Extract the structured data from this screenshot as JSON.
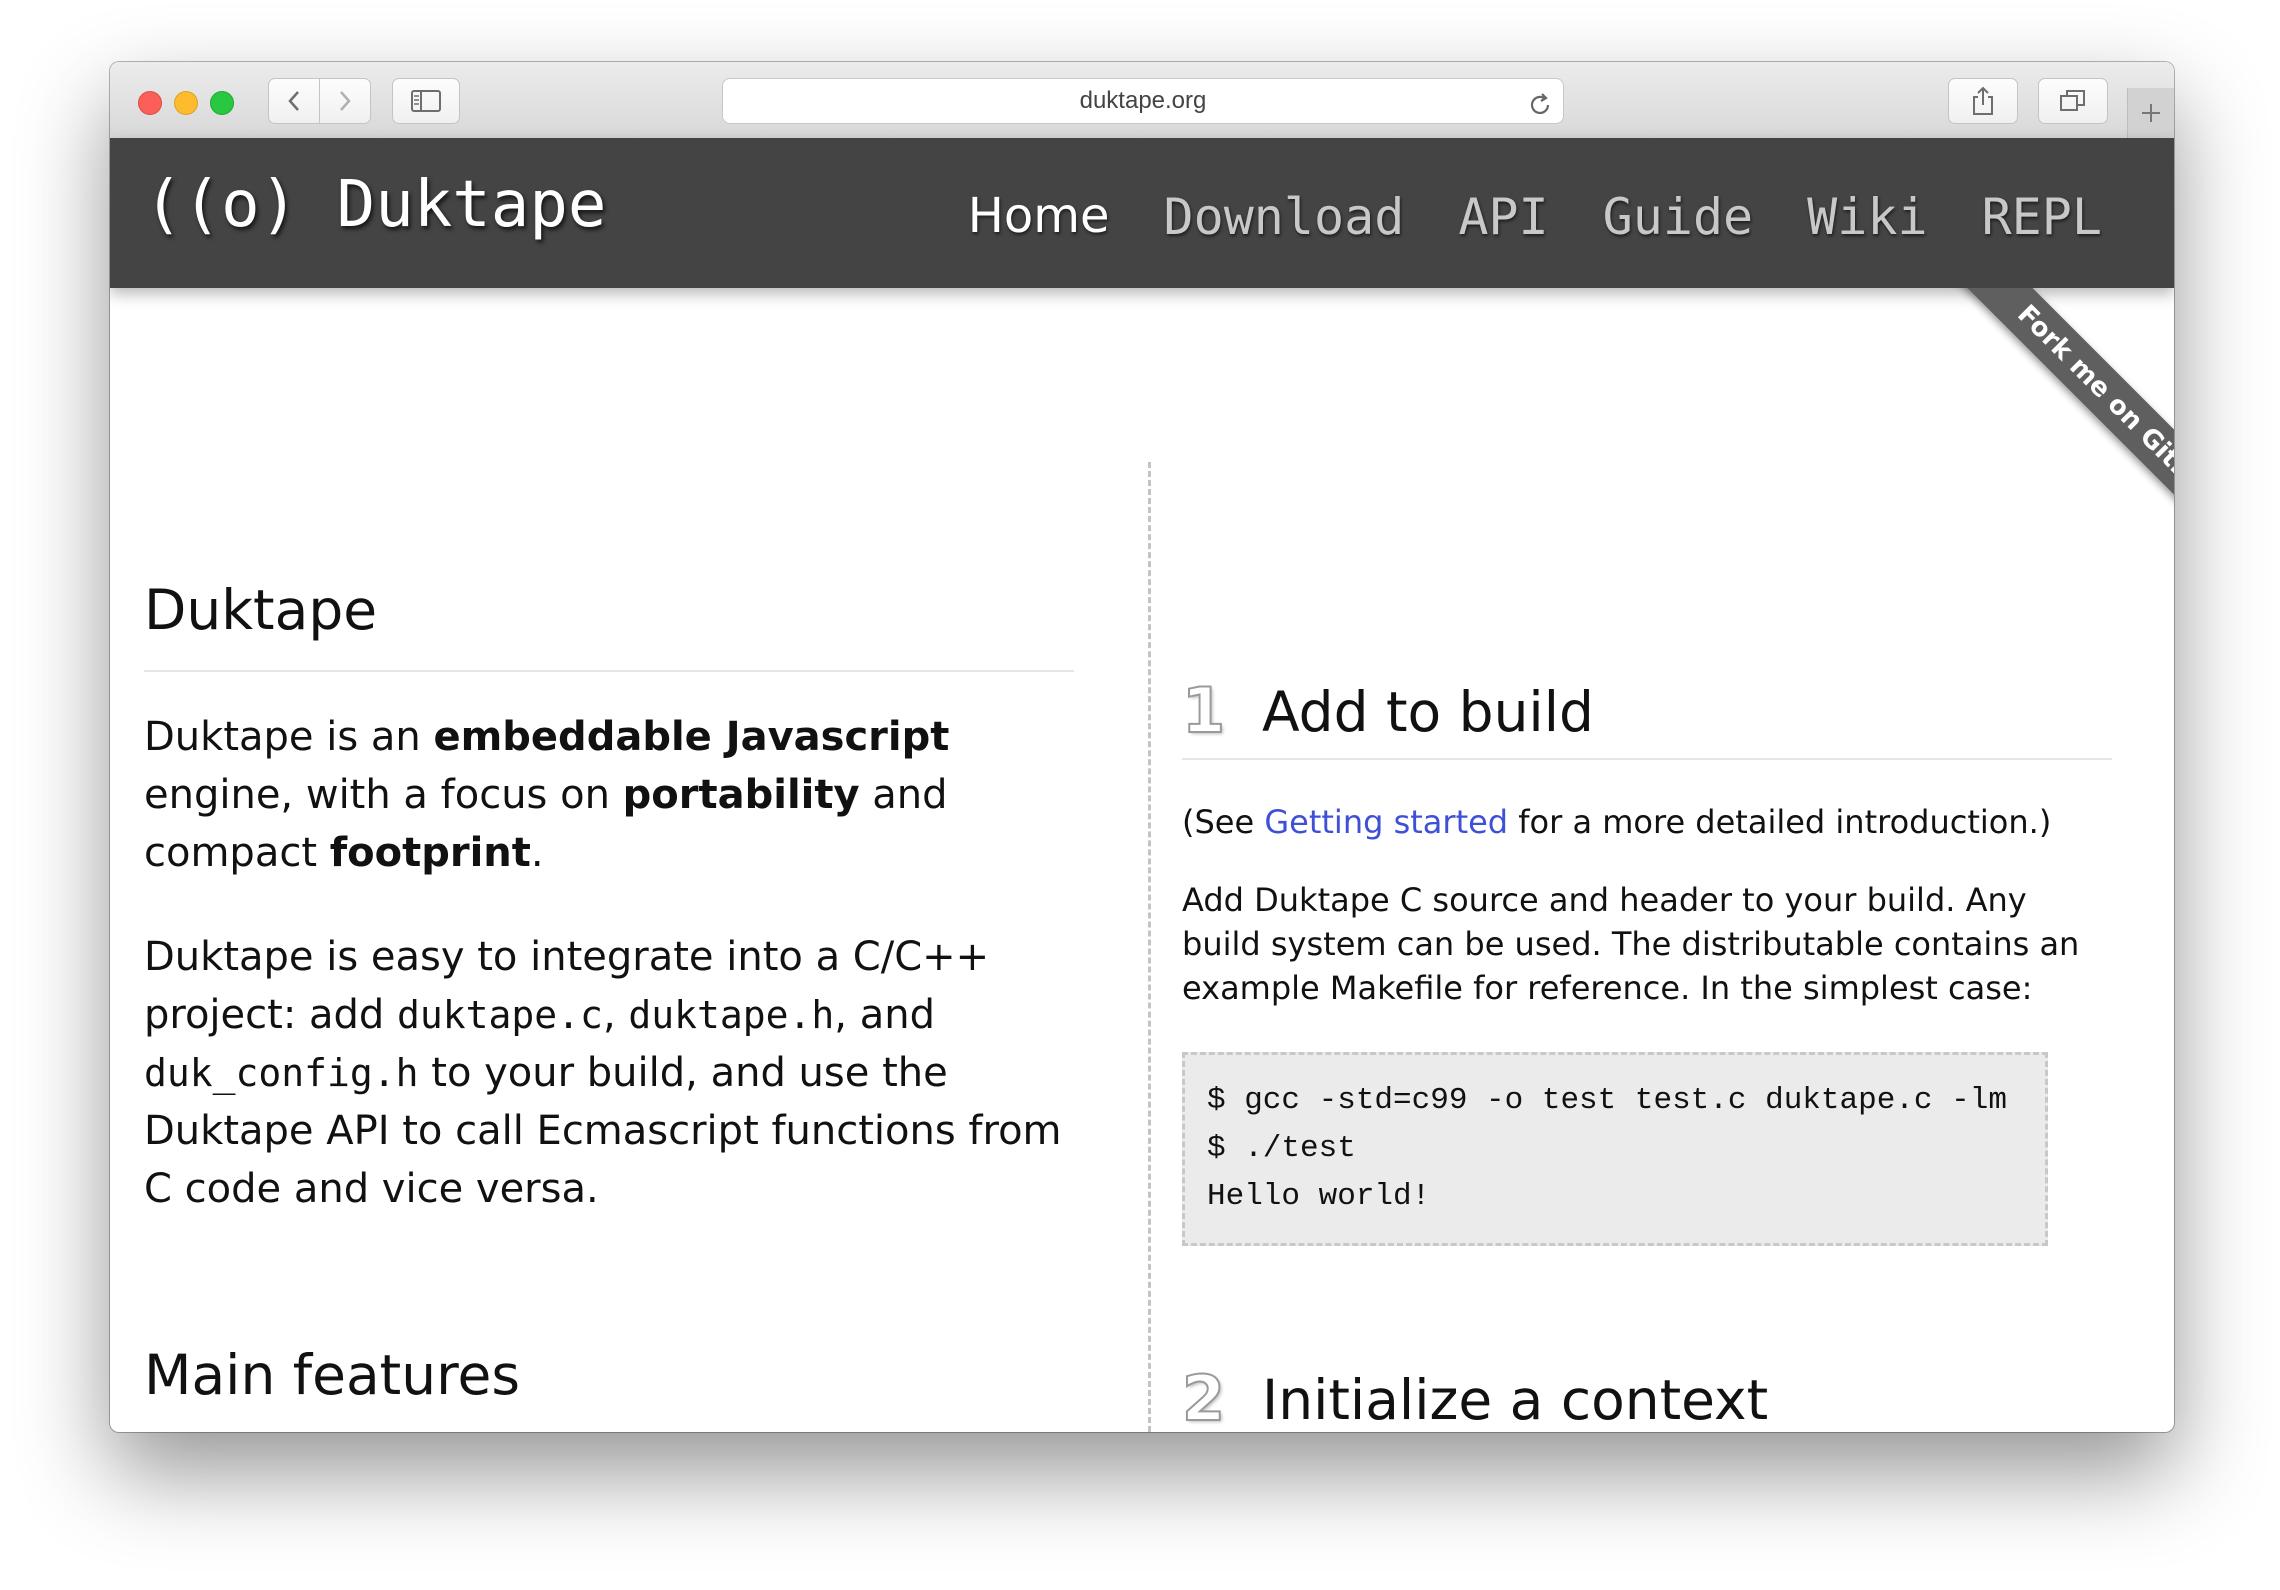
{
  "browser": {
    "url": "duktape.org"
  },
  "header": {
    "logo": "((o) Duktape",
    "nav": [
      "Home",
      "Download",
      "API",
      "Guide",
      "Wiki",
      "REPL"
    ],
    "active_nav": "Home"
  },
  "ribbon": {
    "label": "Fork me on GitHub"
  },
  "left": {
    "title": "Duktape",
    "p1": {
      "t1": "Duktape is an ",
      "b1": "embeddable Javascript",
      "t2": " engine, with a focus on ",
      "b2": "portability",
      "t3": " and compact ",
      "b3": "footprint",
      "t4": "."
    },
    "p2": {
      "t1": "Duktape is easy to integrate into a C/C++ project: add ",
      "c1": "duktape.c",
      "t2": ", ",
      "c2": "duktape.h",
      "t3": ", and ",
      "c3": "duk_config.h",
      "t4": " to your build, and use the Duktape API to call Ecmascript functions from C code and vice versa."
    },
    "features_title": "Main features"
  },
  "right": {
    "step1": {
      "number": "1",
      "title": "Add to build",
      "see_prefix": "(See ",
      "see_link": "Getting started",
      "see_suffix": " for a more detailed introduction.)",
      "desc": "Add Duktape C source and header to your build. Any build system can be used. The distributable contains an example Makefile for reference. In the simplest case:",
      "code": [
        "$ gcc -std=c99 -o test test.c duktape.c -lm",
        "$ ./test",
        "Hello world!"
      ]
    },
    "step2": {
      "number": "2",
      "title": "Initialize a context"
    }
  }
}
